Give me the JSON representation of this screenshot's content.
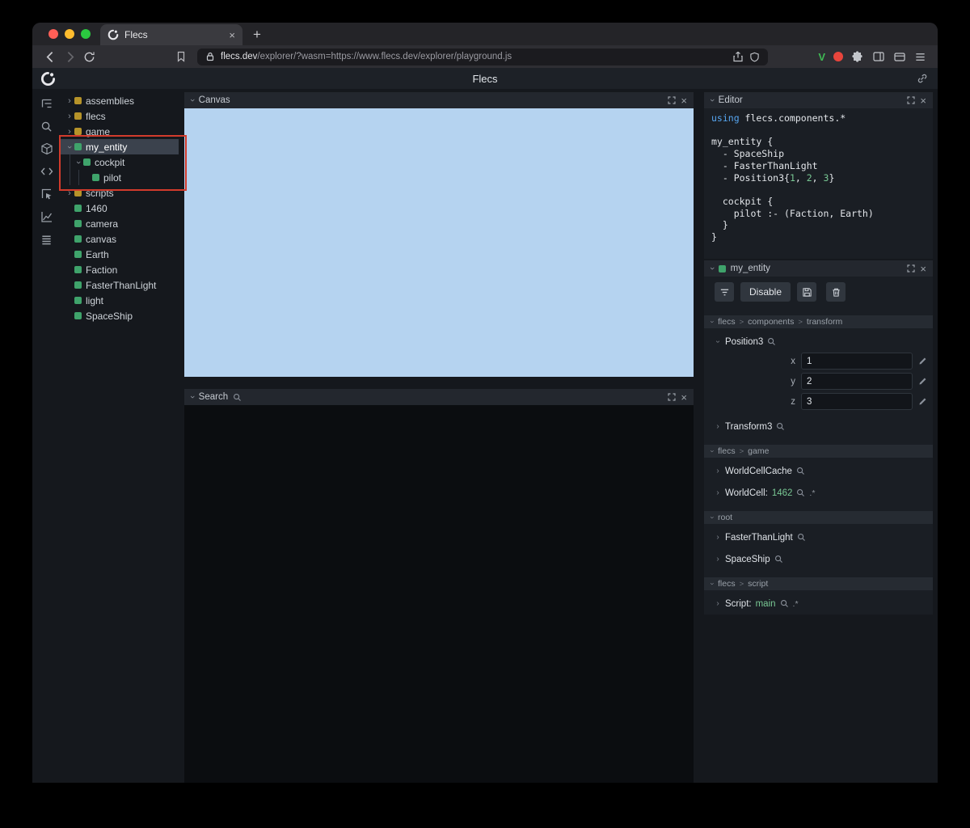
{
  "colors": {
    "module_square": "#b69329",
    "entity_square": "#3fa36b",
    "canvas_blue": "#b5d3f0",
    "annotation_red": "#d23b2c",
    "keyword_blue": "#57a7f2",
    "value_green": "#79c894",
    "vimium_green": "#3fba54"
  },
  "glyphs": {
    "chevron": "›",
    "close": "×",
    "breadcrumb_sep": ">"
  },
  "browser": {
    "tab_title": "Flecs",
    "new_tab": "+",
    "url_domain": "flecs.dev",
    "url_path": "/explorer/?wasm=https://www.flecs.dev/explorer/playground.js",
    "vimium_label": "V"
  },
  "app_header": {
    "title": "Flecs"
  },
  "tree": {
    "items": [
      {
        "label": "assemblies",
        "kind": "module",
        "depth": 0,
        "chevron": "collapsed"
      },
      {
        "label": "flecs",
        "kind": "module",
        "depth": 0,
        "chevron": "collapsed"
      },
      {
        "label": "game",
        "kind": "module",
        "depth": 0,
        "chevron": "collapsed"
      },
      {
        "label": "my_entity",
        "kind": "entity",
        "depth": 0,
        "chevron": "expanded",
        "selected": true
      },
      {
        "label": "cockpit",
        "kind": "entity",
        "depth": 1,
        "chevron": "expanded"
      },
      {
        "label": "pilot",
        "kind": "entity",
        "depth": 2,
        "chevron": "none"
      },
      {
        "label": "scripts",
        "kind": "module",
        "depth": 0,
        "chevron": "collapsed"
      },
      {
        "label": "1460",
        "kind": "entity",
        "depth": 0,
        "chevron": "none"
      },
      {
        "label": "camera",
        "kind": "entity",
        "depth": 0,
        "chevron": "none"
      },
      {
        "label": "canvas",
        "kind": "entity",
        "depth": 0,
        "chevron": "none"
      },
      {
        "label": "Earth",
        "kind": "entity",
        "depth": 0,
        "chevron": "none"
      },
      {
        "label": "Faction",
        "kind": "entity",
        "depth": 0,
        "chevron": "none"
      },
      {
        "label": "FasterThanLight",
        "kind": "entity",
        "depth": 0,
        "chevron": "none"
      },
      {
        "label": "light",
        "kind": "entity",
        "depth": 0,
        "chevron": "none"
      },
      {
        "label": "SpaceShip",
        "kind": "entity",
        "depth": 0,
        "chevron": "none"
      }
    ]
  },
  "panels": {
    "canvas": {
      "title": "Canvas"
    },
    "search": {
      "title": "Search"
    },
    "editor": {
      "title": "Editor"
    },
    "inspector": {
      "title": "my_entity"
    }
  },
  "editor": {
    "code": [
      {
        "tokens": [
          {
            "text": "using",
            "style": "keyword"
          },
          {
            "text": " flecs.components.*",
            "style": "plain"
          }
        ]
      },
      {
        "tokens": []
      },
      {
        "tokens": [
          {
            "text": "my_entity {",
            "style": "plain"
          }
        ]
      },
      {
        "tokens": [
          {
            "text": "  - SpaceShip",
            "style": "plain"
          }
        ]
      },
      {
        "tokens": [
          {
            "text": "  - FasterThanLight",
            "style": "plain"
          }
        ]
      },
      {
        "tokens": [
          {
            "text": "  - Position3{",
            "style": "plain"
          },
          {
            "text": "1",
            "style": "number"
          },
          {
            "text": ", ",
            "style": "plain"
          },
          {
            "text": "2",
            "style": "number"
          },
          {
            "text": ", ",
            "style": "plain"
          },
          {
            "text": "3",
            "style": "number"
          },
          {
            "text": "}",
            "style": "plain"
          }
        ]
      },
      {
        "tokens": []
      },
      {
        "tokens": [
          {
            "text": "  cockpit {",
            "style": "plain"
          }
        ]
      },
      {
        "tokens": [
          {
            "text": "    pilot :- (Faction, Earth)",
            "style": "plain"
          }
        ]
      },
      {
        "tokens": [
          {
            "text": "  }",
            "style": "plain"
          }
        ]
      },
      {
        "tokens": [
          {
            "text": "}",
            "style": "plain"
          }
        ]
      }
    ]
  },
  "inspector": {
    "toolbar": {
      "disable": "Disable"
    },
    "sections": [
      {
        "path": [
          "flecs",
          "components",
          "transform"
        ],
        "items": [
          {
            "name": "Position3",
            "expanded": true,
            "fields": [
              {
                "label": "x",
                "value": "1"
              },
              {
                "label": "y",
                "value": "2"
              },
              {
                "label": "z",
                "value": "3"
              }
            ]
          },
          {
            "name": "Transform3"
          }
        ]
      },
      {
        "path": [
          "flecs",
          "game"
        ],
        "items": [
          {
            "name": "WorldCellCache"
          },
          {
            "name": "WorldCell:",
            "value": "1462",
            "suffix": ".*"
          }
        ]
      },
      {
        "path": [
          "root"
        ],
        "items": [
          {
            "name": "FasterThanLight"
          },
          {
            "name": "SpaceShip"
          }
        ]
      },
      {
        "path": [
          "flecs",
          "script"
        ],
        "items": [
          {
            "name": "Script:",
            "value": "main",
            "suffix": ".*"
          }
        ]
      }
    ]
  }
}
